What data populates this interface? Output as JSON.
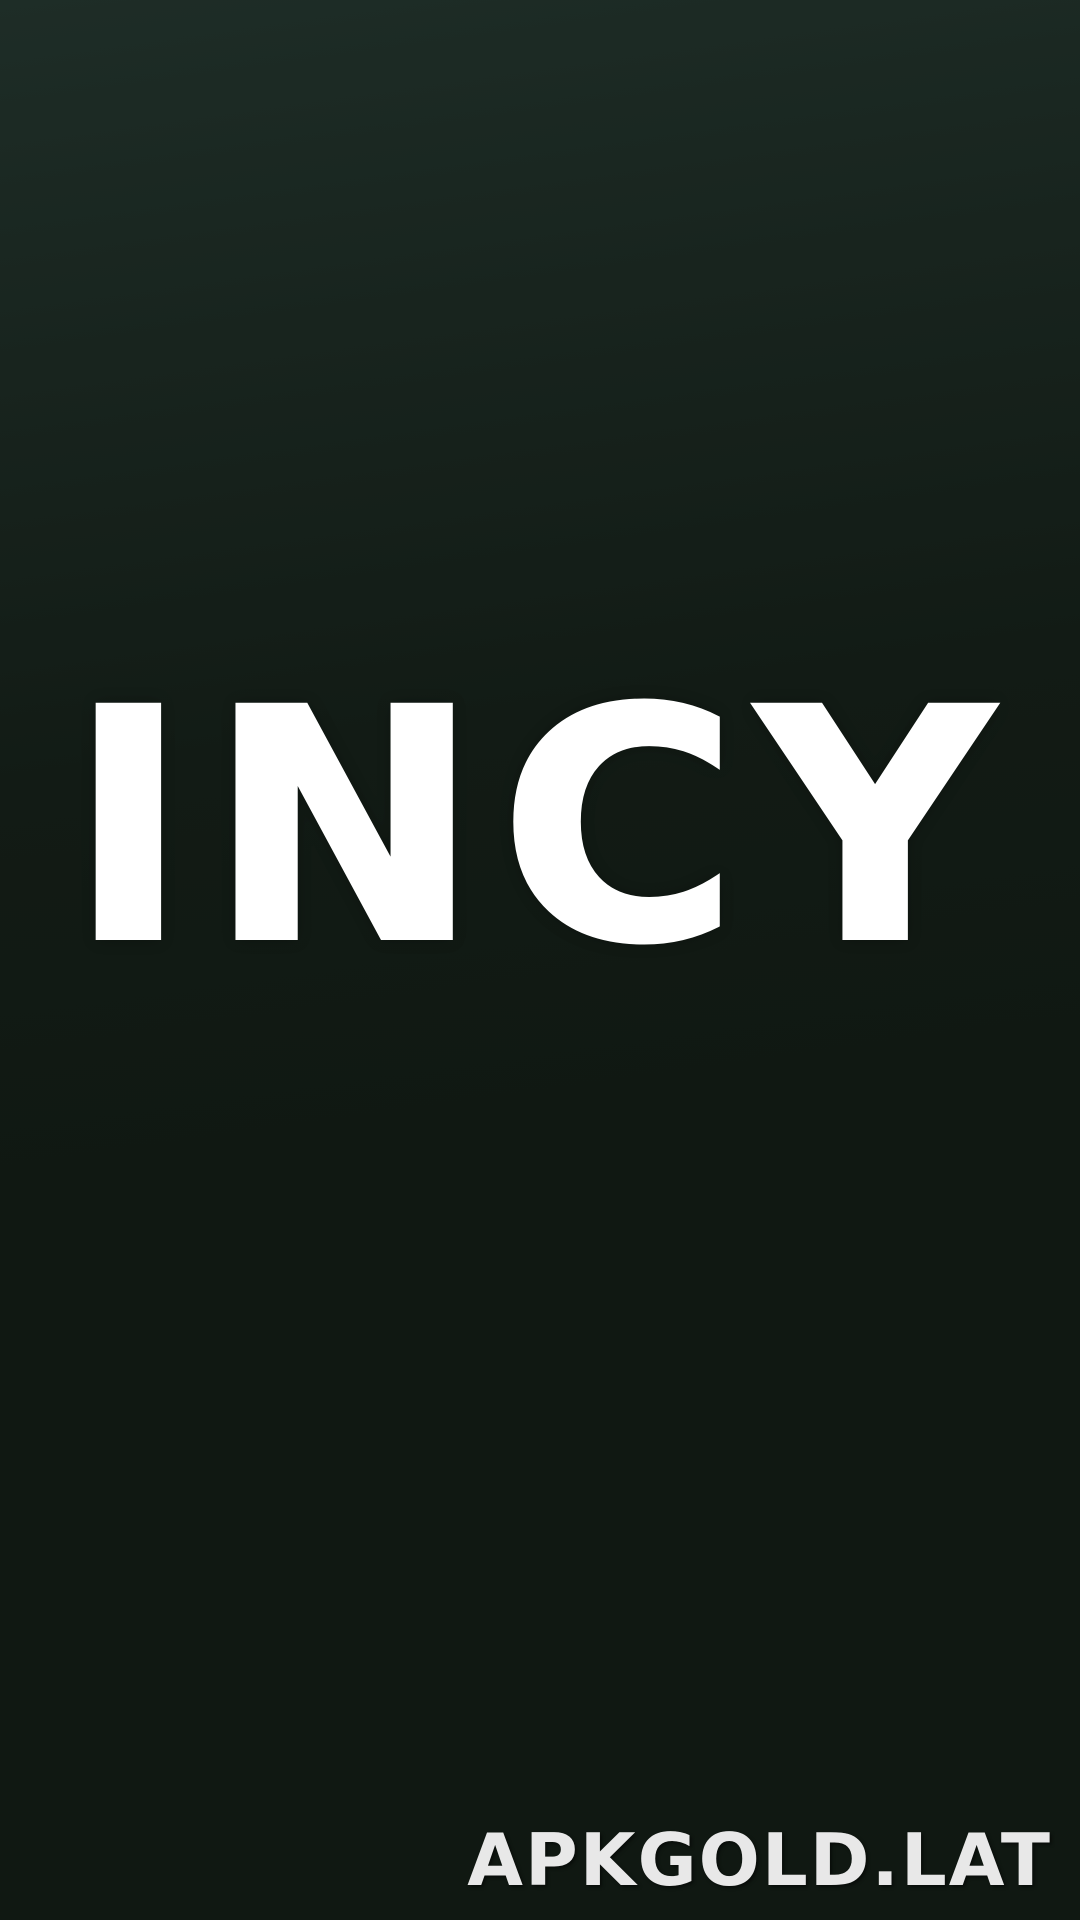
{
  "splash": {
    "logo_text": "INCY",
    "background_color": "#101812",
    "logo_color": "#ffffff"
  },
  "watermark": {
    "text": "APKGOLD.LAT"
  }
}
